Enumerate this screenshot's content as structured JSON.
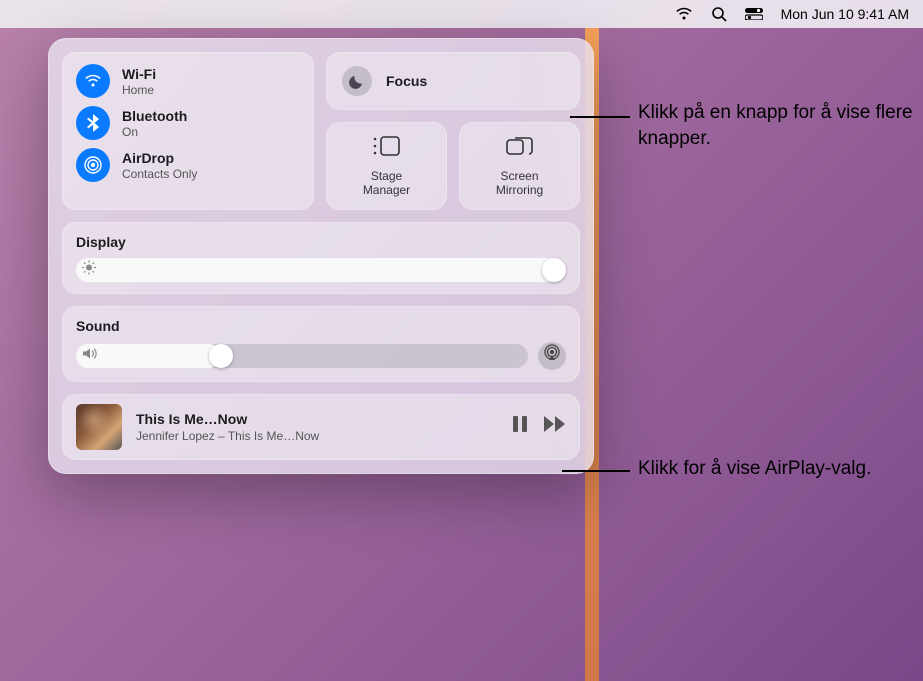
{
  "menubar": {
    "datetime": "Mon Jun 10  9:41 AM"
  },
  "network": {
    "wifi": {
      "title": "Wi-Fi",
      "sub": "Home"
    },
    "bluetooth": {
      "title": "Bluetooth",
      "sub": "On"
    },
    "airdrop": {
      "title": "AirDrop",
      "sub": "Contacts Only"
    }
  },
  "focus": {
    "label": "Focus"
  },
  "tiles": {
    "stage": "Stage\nManager",
    "mirror": "Screen\nMirroring"
  },
  "display": {
    "label": "Display",
    "value_pct": 100
  },
  "sound": {
    "label": "Sound",
    "value_pct": 32
  },
  "media": {
    "title": "This Is Me…Now",
    "sub": "Jennifer Lopez – This Is Me…Now"
  },
  "callouts": {
    "focus": "Klikk på en knapp for å vise flere knapper.",
    "airplay": "Klikk for å vise AirPlay-valg."
  }
}
